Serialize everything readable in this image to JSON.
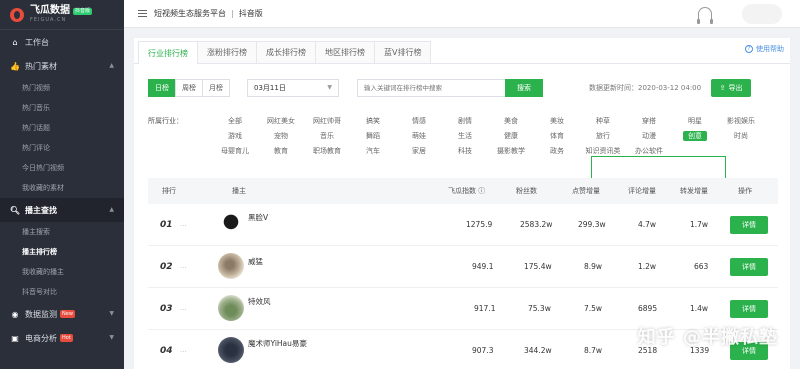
{
  "sidebar": {
    "logo_cn": "飞瓜数据",
    "logo_badge": "抖音版",
    "logo_en": "FEIGUA.CN",
    "workbench": "工作台",
    "hot_materials": "热门素材",
    "hot_items": [
      "热门视频",
      "热门音乐",
      "热门话题",
      "热门评论",
      "今日热门视频",
      "我收藏的素材"
    ],
    "streamer_search": "播主查找",
    "streamer_items": [
      "播主搜索",
      "播主排行榜",
      "我收藏的播主",
      "抖音号对比"
    ],
    "data_monitor": "数据监测",
    "data_monitor_badge": "New",
    "ecommerce": "电商分析",
    "ecommerce_badge": "Hot"
  },
  "topbar": {
    "crumb1": "短视频生态服务平台",
    "crumb_sep": "|",
    "crumb2": "抖音版"
  },
  "tabs": [
    "行业排行榜",
    "涨粉排行榜",
    "成长排行榜",
    "地区排行榜",
    "蓝V排行榜"
  ],
  "help": "使用帮助",
  "controls": {
    "periods": [
      "日榜",
      "周榜",
      "月榜"
    ],
    "date": "03月11日",
    "search_placeholder": "输入关键词在排行榜中搜索",
    "search_btn": "搜索",
    "update_time": "数据更新时间：2020-03-12 04:00",
    "export": "导出"
  },
  "industry": {
    "label": "所属行业：",
    "rows": [
      [
        "全部",
        "网红美女",
        "网红帅哥",
        "搞笑",
        "情感",
        "剧情",
        "美食",
        "美妆",
        "种草",
        "穿搭",
        "明星",
        "影视娱乐"
      ],
      [
        "游戏",
        "宠物",
        "音乐",
        "舞蹈",
        "萌娃",
        "生活",
        "健康",
        "体育",
        "旅行",
        "动漫",
        "创意",
        "时尚"
      ],
      [
        "母婴育儿",
        "教育",
        "职场教育",
        "汽车",
        "家居",
        "科技",
        "摄影教学",
        "政务",
        "知识资讯类",
        "办公软件"
      ]
    ],
    "active": "创意"
  },
  "table": {
    "headers": {
      "rank": "排行",
      "streamer": "播主",
      "index": "飞瓜指数",
      "fans": "粉丝数",
      "likes": "点赞增量",
      "comments": "评论增量",
      "shares": "转发增量",
      "action": "操作"
    },
    "rows": [
      {
        "rank": "01",
        "dots": "...",
        "name": "黑脸V",
        "index": "1275.9",
        "fans": "2583.2w",
        "likes": "299.3w",
        "comments": "4.7w",
        "shares": "1.7w",
        "action": "详情"
      },
      {
        "rank": "02",
        "dots": "...",
        "name": "威猛",
        "index": "949.1",
        "fans": "175.4w",
        "likes": "8.9w",
        "comments": "1.2w",
        "shares": "663",
        "action": "详情"
      },
      {
        "rank": "03",
        "dots": "...",
        "name": "特效风",
        "index": "917.1",
        "fans": "75.3w",
        "likes": "7.5w",
        "comments": "6895",
        "shares": "1.4w",
        "action": "详情"
      },
      {
        "rank": "04",
        "dots": "...",
        "name": "魔术师YiHau易豪",
        "index": "907.3",
        "fans": "344.2w",
        "likes": "8.7w",
        "comments": "2518",
        "shares": "1339",
        "action": "详情"
      }
    ]
  },
  "watermark": "知乎 @半撇私塾"
}
